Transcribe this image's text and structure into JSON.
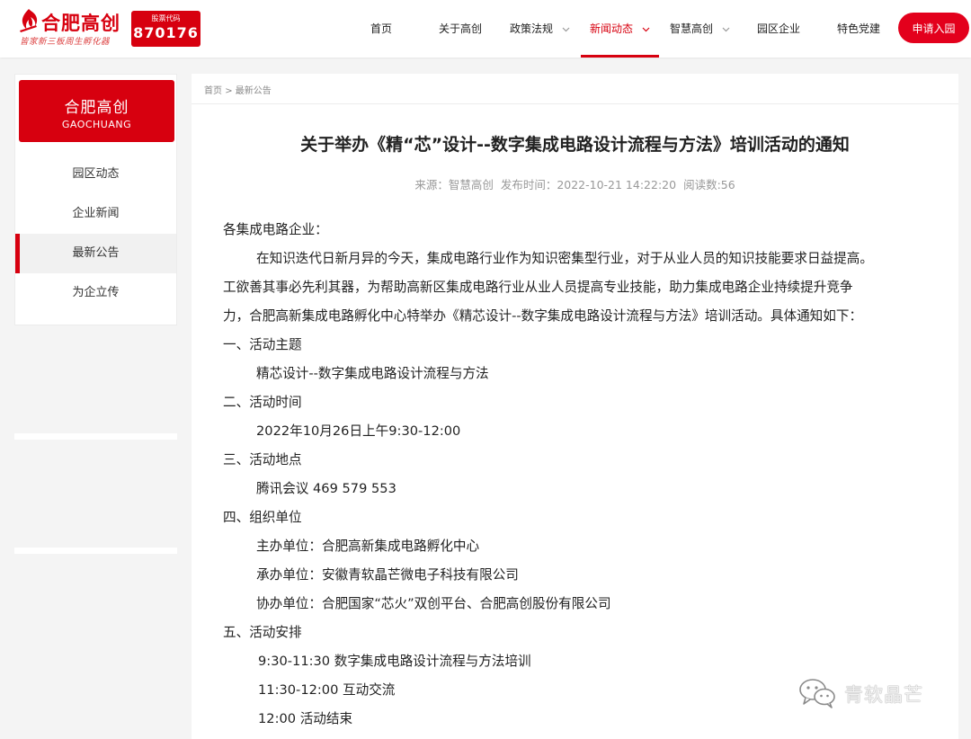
{
  "brand": {
    "name": "合肥高创",
    "slogan": "皆家新三板周生孵化器",
    "stock_label": "股票代码",
    "stock_code": "870176",
    "accent_color": "#d7000f"
  },
  "nav": {
    "items": [
      {
        "label": "首页",
        "dropdown": false,
        "active": false
      },
      {
        "label": "关于高创",
        "dropdown": false,
        "active": false
      },
      {
        "label": "政策法规",
        "dropdown": true,
        "active": false
      },
      {
        "label": "新闻动态",
        "dropdown": true,
        "active": true
      },
      {
        "label": "智慧高创",
        "dropdown": true,
        "active": false
      },
      {
        "label": "园区企业",
        "dropdown": false,
        "active": false
      },
      {
        "label": "特色党建",
        "dropdown": false,
        "active": false
      }
    ],
    "apply_label": "申请入园"
  },
  "sidebar": {
    "title": "合肥高创",
    "subtitle": "GAOCHUANG",
    "items": [
      {
        "label": "园区动态",
        "active": false
      },
      {
        "label": "企业新闻",
        "active": false
      },
      {
        "label": "最新公告",
        "active": true
      },
      {
        "label": "为企立传",
        "active": false
      }
    ]
  },
  "breadcrumb": {
    "home": "首页",
    "separator": ">",
    "current": "最新公告"
  },
  "article": {
    "title": "关于举办《精“芯”设计--数字集成电路设计流程与方法》培训活动的通知",
    "meta": {
      "source": "来源：智慧高创",
      "published": "发布时间：2022-10-21 14:22:20",
      "views": "阅读数:56"
    },
    "lines": [
      "各集成电路企业：",
      "在知识迭代日新月异的今天，集成电路行业作为知识密集型行业，对于从业人员的知识技能要求日益提高。",
      "工欲善其事必先利其器，为帮助高新区集成电路行业从业人员提高专业技能，助力集成电路企业持续提升竞争",
      "力，合肥高新集成电路孵化中心特举办《精芯设计--数字集成电路设计流程与方法》培训活动。具体通知如下：",
      "一、活动主题",
      "精芯设计--数字集成电路设计流程与方法",
      "二、活动时间",
      "2022年10月26日上午9:30-12:00",
      "三、活动地点",
      "腾讯会议 469 579 553",
      "四、组织单位",
      "主办单位：合肥高新集成电路孵化中心",
      "承办单位：安徽青软晶芒微电子科技有限公司",
      "协办单位：合肥国家“芯火”双创平台、合肥高创股份有限公司",
      "五、活动安排",
      "9:30-11:30 数字集成电路设计流程与方法培训",
      "11:30-12:00 互动交流",
      "12:00 活动结束"
    ]
  },
  "watermark": {
    "icon": "wechat-icon",
    "text": "青软晶芒"
  }
}
